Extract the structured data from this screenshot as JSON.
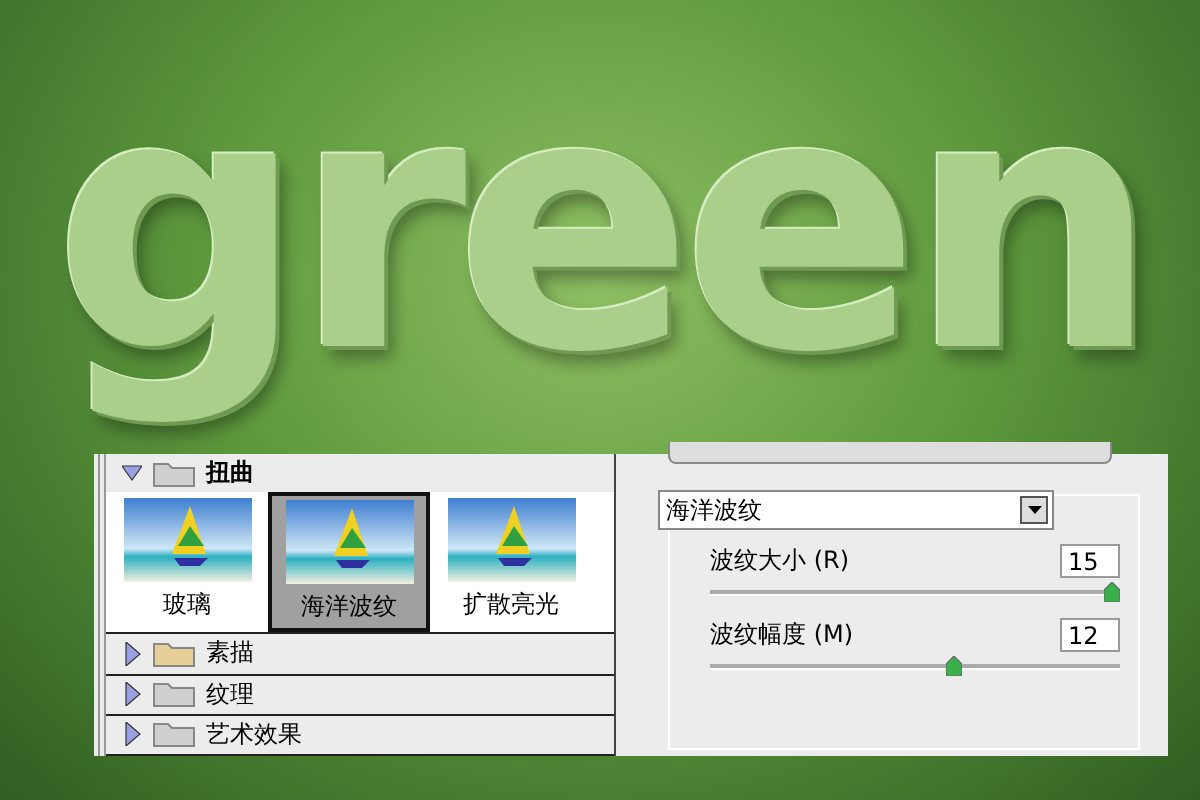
{
  "artwork": {
    "headline": "green"
  },
  "filter_gallery": {
    "categories": [
      {
        "name": "扭曲",
        "expanded": true,
        "filters": [
          {
            "label": "玻璃",
            "selected": false
          },
          {
            "label": "海洋波纹",
            "selected": true
          },
          {
            "label": "扩散亮光",
            "selected": false
          }
        ]
      },
      {
        "name": "素描",
        "expanded": false
      },
      {
        "name": "纹理",
        "expanded": false
      },
      {
        "name": "艺术效果",
        "expanded": false
      }
    ]
  },
  "settings": {
    "filter": "海洋波纹",
    "params": [
      {
        "label": "波纹大小 (R)",
        "value": "15",
        "level": 1.0
      },
      {
        "label": "波纹幅度 (M)",
        "value": "12",
        "level": 0.6
      }
    ]
  }
}
